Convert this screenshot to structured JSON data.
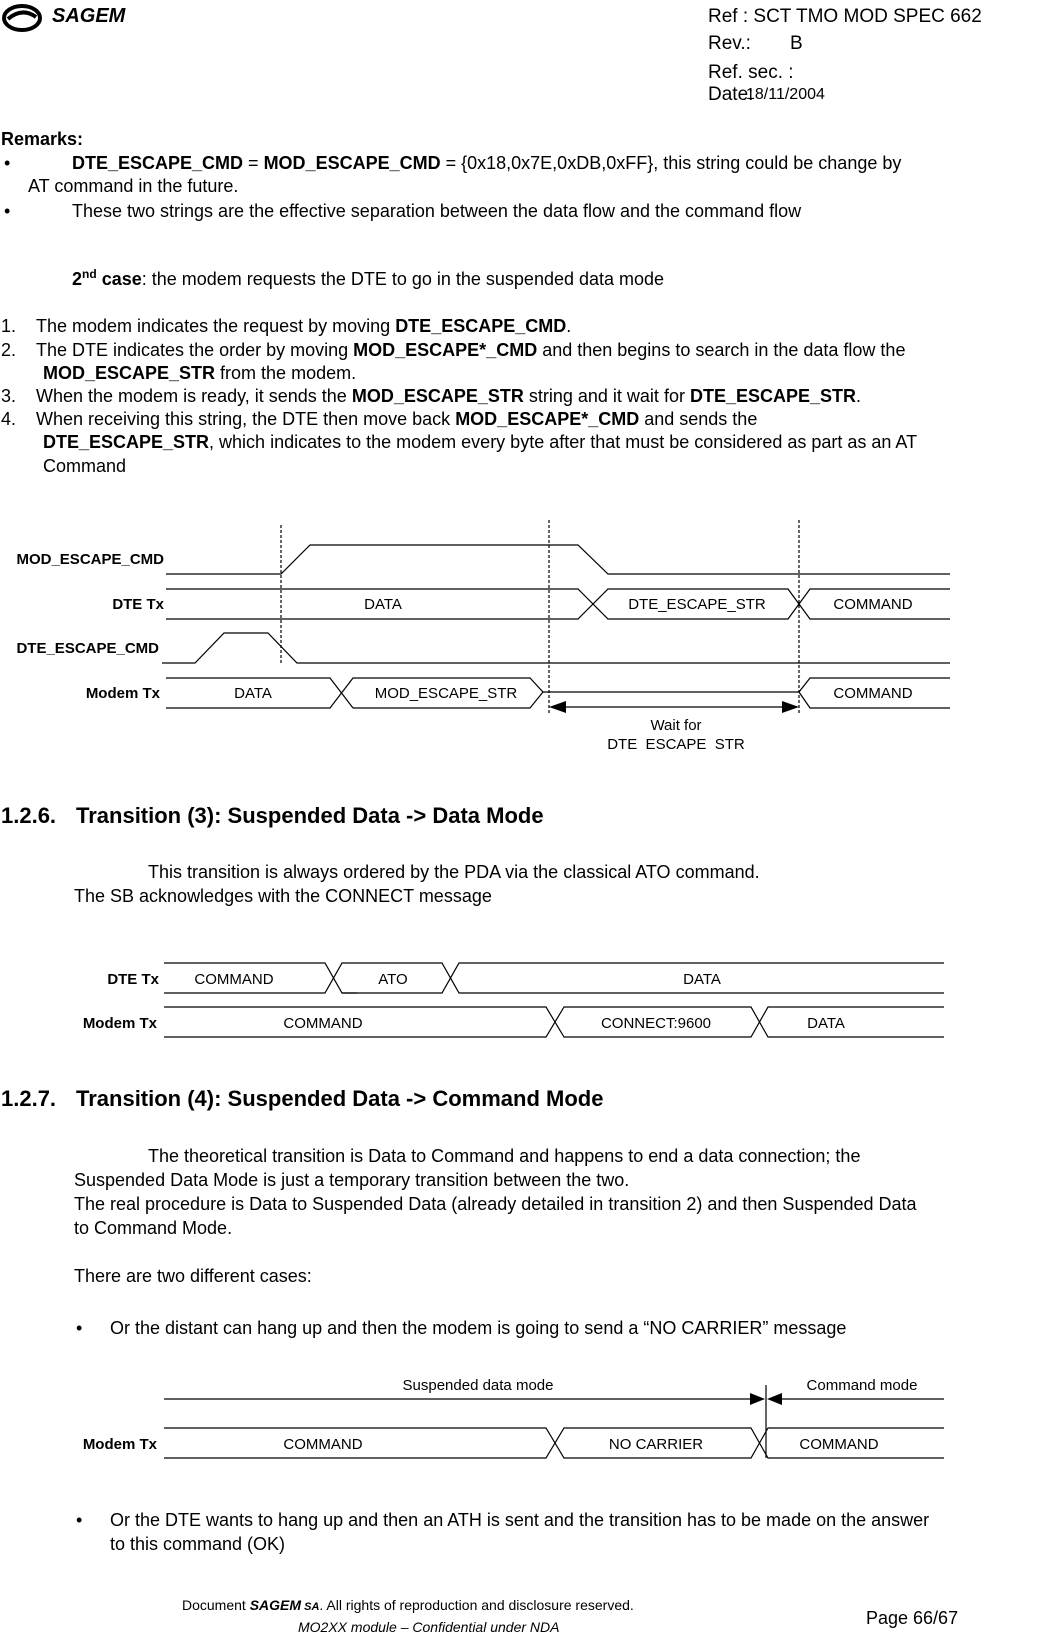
{
  "header": {
    "logo_text": "SAGEM",
    "ref": "Ref : SCT TMO MOD SPEC 662",
    "rev_label": "Rev.:",
    "rev_value": "B",
    "ref_sec": "Ref. sec. :",
    "date_label": "Date:",
    "date_value": "18/11/2004"
  },
  "remarks": {
    "title": "Remarks:",
    "bullet1": {
      "b1": "DTE_ESCAPE_CMD",
      "eq1": " = ",
      "b2": "MOD_ESCAPE_CMD",
      "rest": " = {0x18,0x7E,0xDB,0xFF}, this string could be change by",
      "cont": "AT command in the future."
    },
    "bullet2": "These two strings are the effective separation between the data flow and the command flow"
  },
  "case2": {
    "sup_num": "2",
    "sup": "nd",
    "bold": " case",
    "rest": ": the modem requests the DTE to go in the suspended data mode"
  },
  "steps": [
    {
      "num": "1.",
      "t1": "The modem indicates the request by moving ",
      "b1": "DTE_ESCAPE_CMD",
      "t2": "."
    },
    {
      "num": "2.",
      "t1": "The DTE indicates the order by moving ",
      "b1": "MOD_ESCAPE*_CMD",
      "t2": " and then begins to search in the data flow the",
      "b2": "MOD_ESCAPE_STR",
      "t3": " from the modem."
    },
    {
      "num": "3.",
      "t1": "When the modem is ready, it sends the ",
      "b1": "MOD_ESCAPE_STR",
      "t2": " string and it wait for ",
      "b2": "DTE_ESCAPE_STR",
      "t3": "."
    },
    {
      "num": "4.",
      "t1": "When receiving this string, the DTE then move back ",
      "b1": "MOD_ESCAPE*_CMD",
      "t2": " and sends the",
      "b2": "DTE_ESCAPE_STR",
      "t3": ", which indicates to the modem every byte after that must be considered as part as an AT",
      "t4": "Command"
    }
  ],
  "diagram1": {
    "signals": [
      "MOD_ESCAPE_CMD",
      "DTE Tx",
      "DTE_ESCAPE_CMD",
      "Modem Tx"
    ],
    "dte_tx": [
      "DATA",
      "DTE_ESCAPE_STR",
      "COMMAND"
    ],
    "modem_tx": [
      "DATA",
      "MOD_ESCAPE_STR",
      "COMMAND"
    ],
    "wait_line1": "Wait for",
    "wait_line2": "DTE_ESCAPE_STR"
  },
  "section126": {
    "number": "1.2.6.",
    "title": "Transition (3): Suspended Data -> Data Mode",
    "p1": "This transition is always ordered by the PDA via the classical ATO command.",
    "p2": "The SB acknowledges with the CONNECT message"
  },
  "diagram2": {
    "signals": [
      "DTE Tx",
      "Modem Tx"
    ],
    "dte_tx": [
      "COMMAND",
      "ATO",
      "DATA"
    ],
    "modem_tx": [
      "COMMAND",
      "CONNECT:9600",
      "DATA"
    ]
  },
  "section127": {
    "number": "1.2.7.",
    "title": "Transition (4): Suspended Data -> Command Mode",
    "p1": "The theoretical transition is Data to Command and happens to end a data connection; the",
    "p2": "Suspended Data Mode is just a temporary transition between the two.",
    "p3": "The real procedure is Data to Suspended Data (already detailed in transition 2) and then Suspended Data",
    "p4": "to Command Mode.",
    "p5": "There are two different cases:",
    "bullet1": "Or the distant can hang up and then the modem is going to send a “NO CARRIER” message",
    "bullet2a": "Or the DTE wants to hang up and then an ATH is sent and the transition has to be made on the answer",
    "bullet2b": "to this command (OK)"
  },
  "diagram3": {
    "mode_left": "Suspended data mode",
    "mode_right": "Command mode",
    "signal": "Modem Tx",
    "modem_tx": [
      "COMMAND",
      "NO CARRIER",
      "COMMAND"
    ]
  },
  "footer": {
    "doc": "Document ",
    "brand": "SAGEM",
    "sa": " SA",
    "rights": ".  All rights of reproduction and disclosure reserved.",
    "line2": "MO2XX module – Confidential under NDA",
    "page": "Page 66/67"
  }
}
